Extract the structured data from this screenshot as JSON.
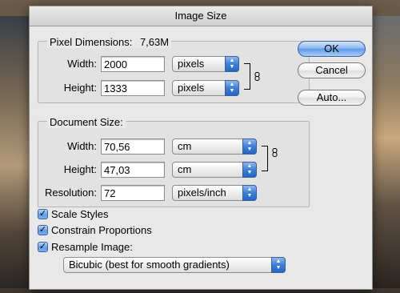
{
  "dialog": {
    "title": "Image Size"
  },
  "pixel_dimensions": {
    "title": "Pixel Dimensions:",
    "size": "7,63M",
    "width_label": "Width:",
    "width_value": "2000",
    "width_unit": "pixels",
    "height_label": "Height:",
    "height_value": "1333",
    "height_unit": "pixels"
  },
  "document_size": {
    "title": "Document Size:",
    "width_label": "Width:",
    "width_value": "70,56",
    "width_unit": "cm",
    "height_label": "Height:",
    "height_value": "47,03",
    "height_unit": "cm",
    "resolution_label": "Resolution:",
    "resolution_value": "72",
    "resolution_unit": "pixels/inch"
  },
  "options": {
    "scale_styles": {
      "label": "Scale Styles",
      "checked": true
    },
    "constrain_proportions": {
      "label": "Constrain Proportions",
      "checked": true
    },
    "resample_image": {
      "label": "Resample Image:",
      "checked": true
    },
    "resample_method": "Bicubic (best for smooth gradients)"
  },
  "buttons": {
    "ok": "OK",
    "cancel": "Cancel",
    "auto": "Auto..."
  },
  "icons": {
    "chain": "chain-link-icon",
    "popup_arrows": "updown-arrows-icon",
    "checkmark": "checkmark-icon"
  },
  "colors": {
    "accent": "#5f9bea",
    "dialog_bg": "#e8e8e8"
  }
}
